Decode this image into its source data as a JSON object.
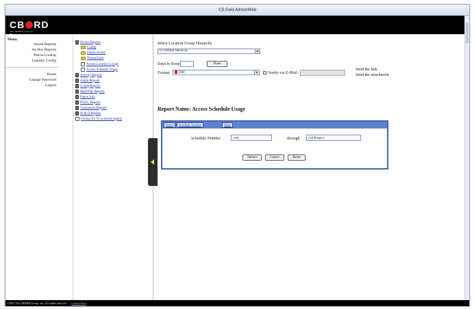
{
  "window": {
    "title": "CS Gold Admin/Web"
  },
  "brand": {
    "logo_left": "CB",
    "logo_right": "RD",
    "logo_reg": "®",
    "subtitle": "The CBORD Group, Inc."
  },
  "left_menu": {
    "title": "Menu",
    "items": [
      {
        "label": "Stored Reports"
      },
      {
        "label": "Ad Hoc Reports"
      },
      {
        "label": "Patron Lookup"
      },
      {
        "label": "Laundry Config"
      }
    ],
    "items2": [
      {
        "label": "Home"
      },
      {
        "label": "Change Password"
      },
      {
        "label": "Logout"
      }
    ]
  },
  "tree": {
    "items": [
      {
        "label": "Access Reports",
        "icon": "report-icon"
      },
      {
        "label": "Config",
        "icon": "folder-icon"
      },
      {
        "label": "Patron Access",
        "icon": "folder-icon"
      },
      {
        "label": "Transactions",
        "icon": "folder-icon"
      },
      {
        "label": "Access Location Groups",
        "icon": "page-icon"
      },
      {
        "label": "Access Schedule Usage",
        "icon": "page-icon"
      },
      {
        "label": "Activity Reports",
        "icon": "report-icon"
      },
      {
        "label": "Alarm Reports",
        "icon": "report-icon"
      },
      {
        "label": "Config Reports",
        "icon": "report-icon"
      },
      {
        "label": "Meal Plan Reports",
        "icon": "report-icon"
      },
      {
        "label": "Patron Info",
        "icon": "report-icon"
      },
      {
        "label": "POS/C Reports",
        "icon": "report-icon"
      },
      {
        "label": "Transaction Reports",
        "icon": "report-icon"
      },
      {
        "label": "W & D Reports",
        "icon": "report-icon"
      },
      {
        "label": "Format XL 'N' in Saved reports",
        "icon": "page-icon"
      }
    ]
  },
  "form": {
    "hierarchy_label": "Select Location Group Hierarchy",
    "hierarchy_value": "(1) Default Hierarchy",
    "days_label": "Days to Keep",
    "days_value": "",
    "share_label": "Share",
    "format_label": "Format",
    "format_value": "PDF",
    "notify_label": "Notify via E-Mail",
    "send_link": "Send the link",
    "send_attach": "Send the attachment"
  },
  "report": {
    "name": "Report Name: Access Schedule Usage",
    "tabs": [
      "Select",
      "Schedule Number",
      "Share"
    ],
    "schedule_label": "Schedule Number",
    "schedule_from": "(All)",
    "through_label": "through",
    "schedule_to": "(All Ranges)",
    "submit": "Submit",
    "cancel": "Cancel",
    "reset": "Reset"
  },
  "footer": {
    "copyright": "©2007 The CBORD Group, Inc. All rights reserved.",
    "contact": "Contact Host"
  },
  "colors": {
    "header_bg": "#000000",
    "logo_red": "#d6232a",
    "panel_border": "#3f65b5",
    "tab_strip": "#5e84cf",
    "link": "#1a2fa8"
  }
}
